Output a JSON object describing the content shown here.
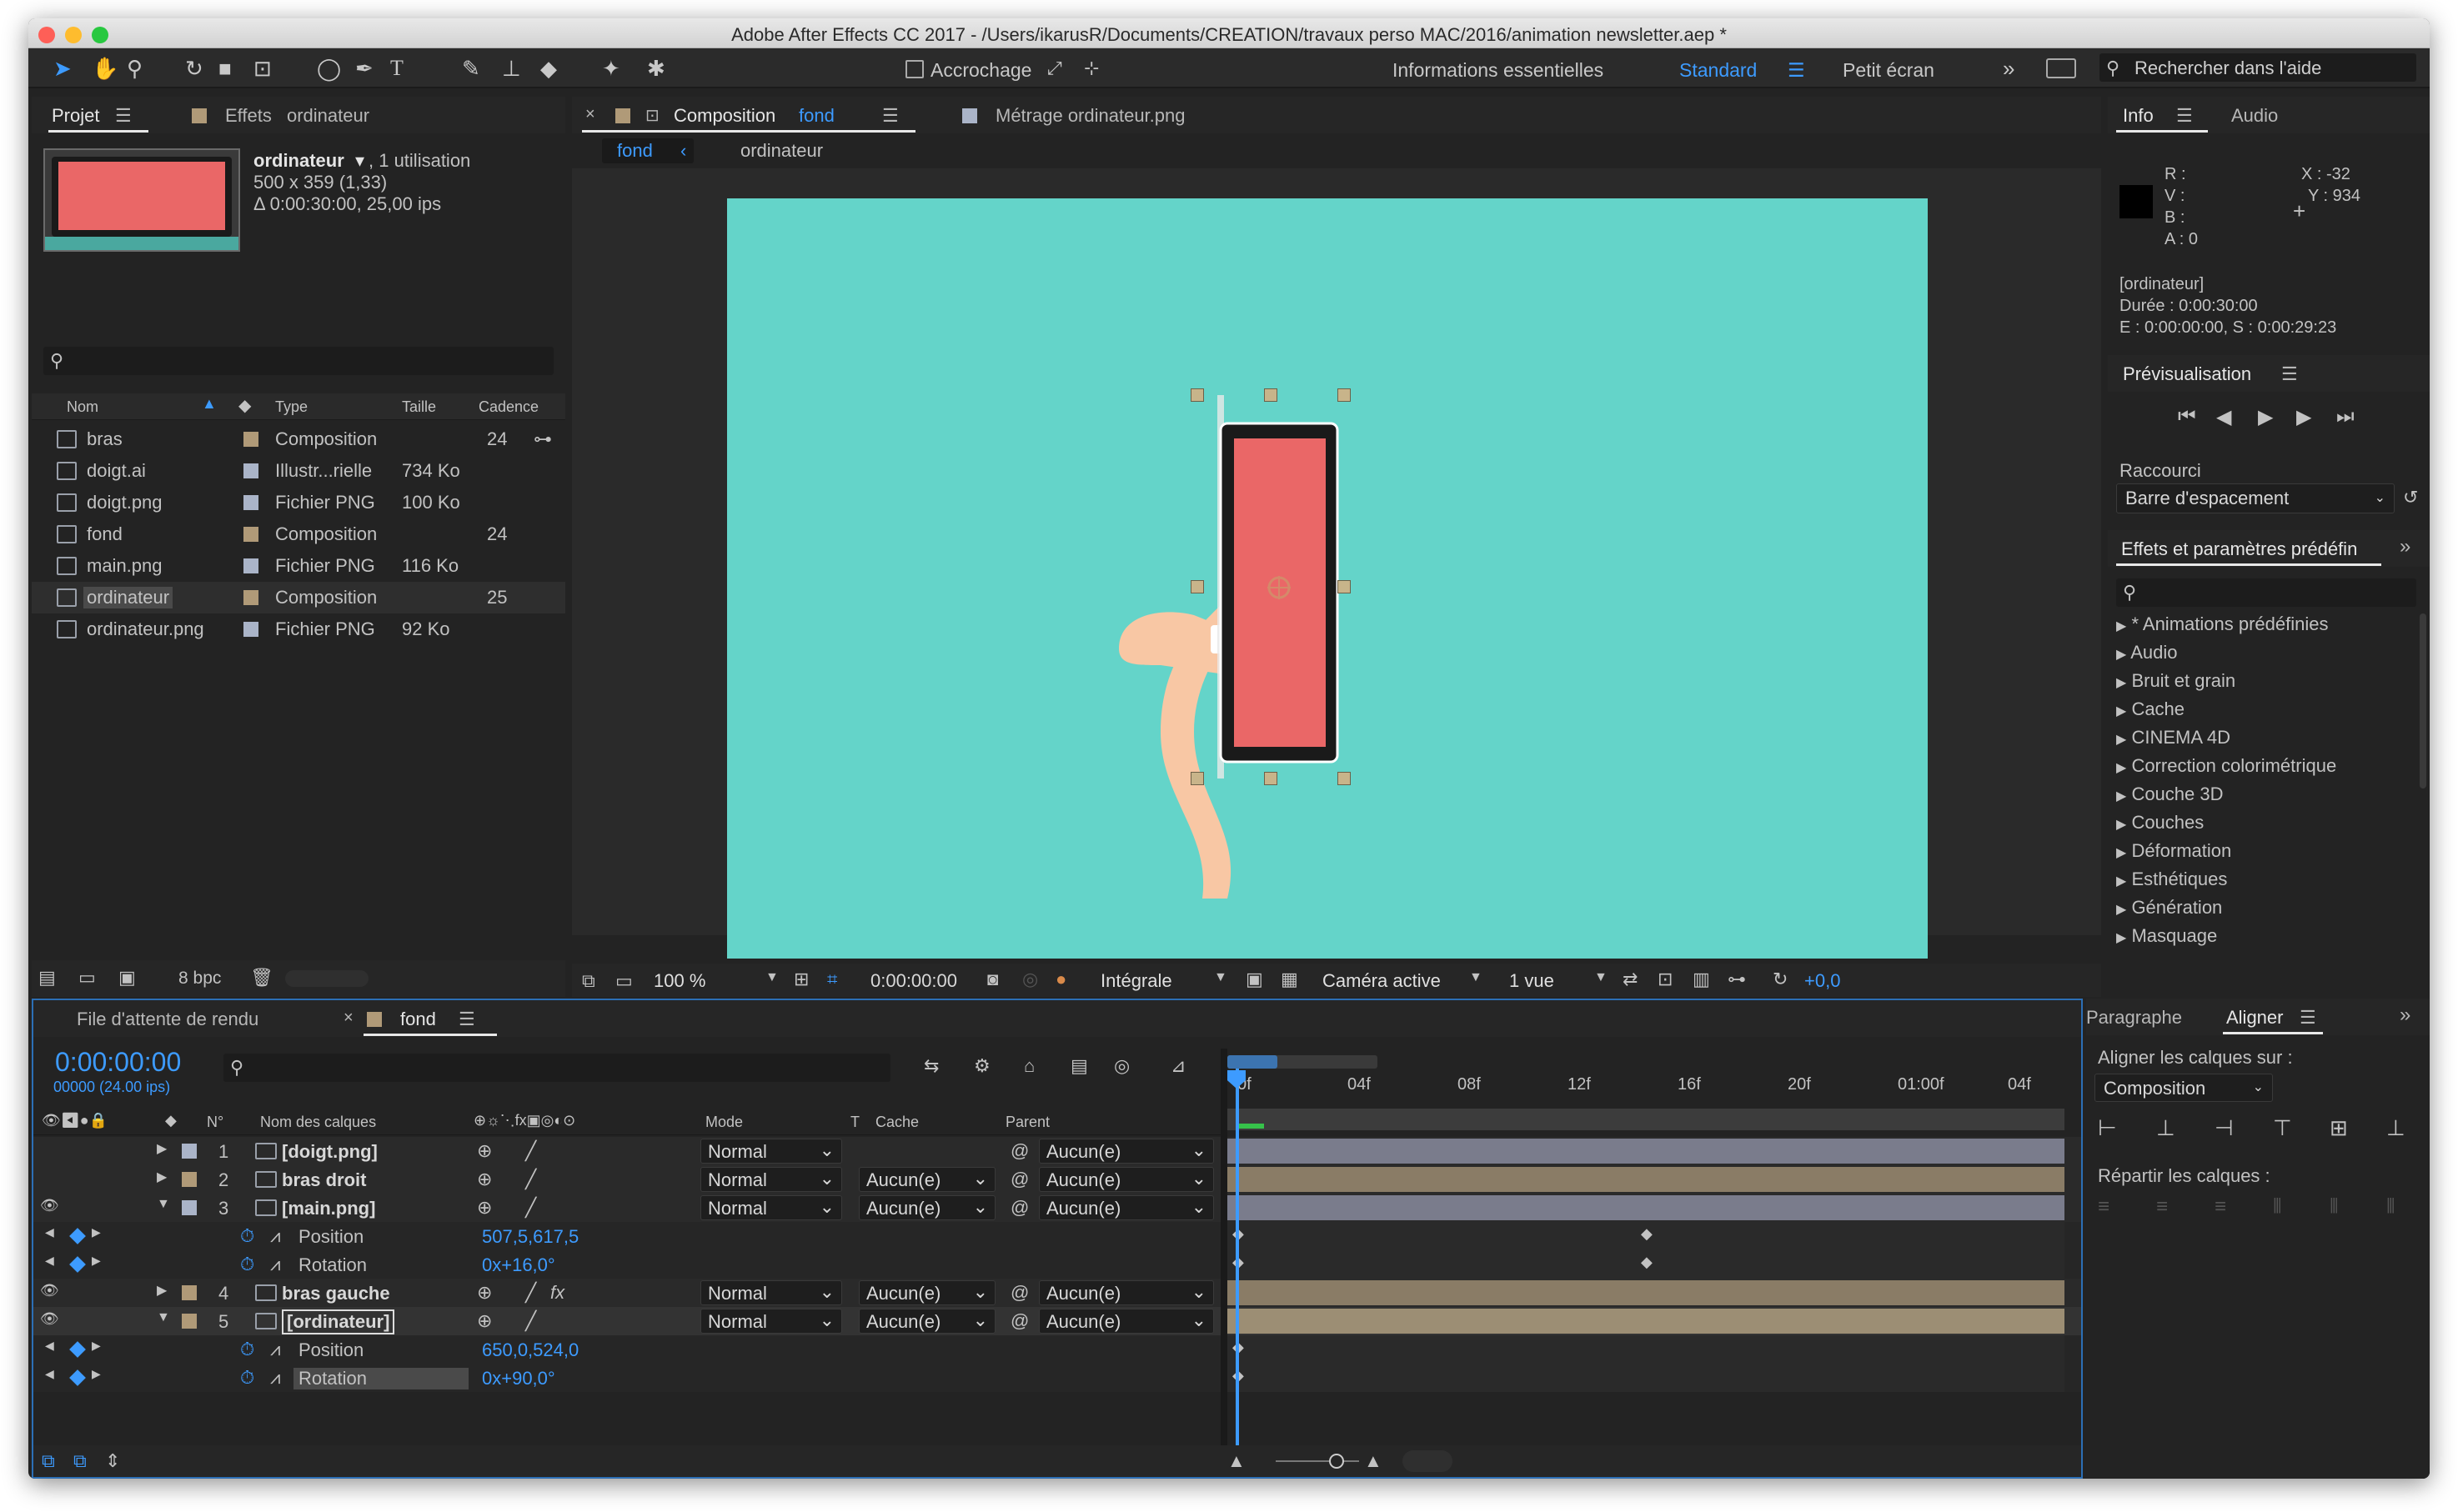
{
  "app": {
    "title": "Adobe After Effects CC 2017 - /Users/ikarusR/Documents/CREATION/travaux perso MAC/2016/animation newsletter.aep *"
  },
  "toolbar": {
    "accrochage": "Accrochage",
    "workspaces": [
      "Informations essentielles",
      "Standard",
      "Petit écran"
    ],
    "search_placeholder": "Rechercher dans l'aide"
  },
  "project": {
    "tab": "Projet",
    "effects_tab": "Effets",
    "effects_target": "ordinateur",
    "preview": {
      "name": "ordinateur",
      "usage": ", 1 utilisation",
      "size": "500 x 359 (1,33)",
      "duration": "Δ 0:00:30:00, 25,00 ips"
    },
    "columns": [
      "Nom",
      "Type",
      "Taille",
      "Cadence"
    ],
    "items": [
      {
        "name": "bras",
        "type": "Composition",
        "size": "",
        "rate": "24",
        "label_color": "#b09a78",
        "icon": "composition-icon"
      },
      {
        "name": "doigt.ai",
        "type": "Illustr...rielle",
        "size": "734 Ko",
        "rate": "",
        "label_color": "#aab4c8",
        "icon": "illustrator-file-icon"
      },
      {
        "name": "doigt.png",
        "type": "Fichier PNG",
        "size": "100 Ko",
        "rate": "",
        "label_color": "#aab4c8",
        "icon": "png-file-icon"
      },
      {
        "name": "fond",
        "type": "Composition",
        "size": "",
        "rate": "24",
        "label_color": "#b09a78",
        "icon": "composition-icon"
      },
      {
        "name": "main.png",
        "type": "Fichier PNG",
        "size": "116 Ko",
        "rate": "",
        "label_color": "#aab4c8",
        "icon": "png-file-icon"
      },
      {
        "name": "ordinateur",
        "type": "Composition",
        "size": "",
        "rate": "25",
        "label_color": "#b09a78",
        "icon": "composition-icon"
      },
      {
        "name": "ordinateur.png",
        "type": "Fichier PNG",
        "size": "92 Ko",
        "rate": "",
        "label_color": "#aab4c8",
        "icon": "png-file-icon"
      }
    ],
    "bpc": "8 bpc"
  },
  "viewer": {
    "comp_tab_prefix": "Composition",
    "comp_tab_name": "fond",
    "footage_tab": "Métrage ordinateur.png",
    "crumb_active": "fond",
    "crumb_child": "ordinateur",
    "zoom": "100 %",
    "timecode": "0:00:00:00",
    "resolution": "Intégrale",
    "camera": "Caméra active",
    "views": "1 vue",
    "exposure": "+0,0",
    "bg_color": "#64d4c9"
  },
  "info": {
    "tab": "Info",
    "audio_tab": "Audio",
    "r": "R :",
    "v": "V :",
    "b": "B :",
    "a": "A : 0",
    "x": "X : -32",
    "y": "Y : 934",
    "layer": "[ordinateur]",
    "duree": "Durée : 0:00:30:00",
    "es": "E : 0:00:00:00, S : 0:00:29:23"
  },
  "preview": {
    "title": "Prévisualisation",
    "raccourci": "Raccourci",
    "shortcut": "Barre d'espacement"
  },
  "effects": {
    "title": "Effets et paramètres prédéfin",
    "items": [
      "* Animations prédéfinies",
      "Audio",
      "Bruit et grain",
      "Cache",
      "CINEMA 4D",
      "Correction colorimétrique",
      "Couche 3D",
      "Couches",
      "Déformation",
      "Esthétiques",
      "Génération",
      "Masquage"
    ]
  },
  "align": {
    "paragraphe": "Paragraphe",
    "aligner": "Aligner",
    "aligner_sur": "Aligner les calques sur :",
    "target": "Composition",
    "repartir": "Répartir les calques :"
  },
  "timeline": {
    "render_queue": "File d'attente de rendu",
    "comp_tab": "fond",
    "timecode": "0:00:00:00",
    "frames": "00000 (24.00 ips)",
    "col_num": "N°",
    "col_name": "Nom des calques",
    "col_mode": "Mode",
    "col_t": "T",
    "col_cache": "Cache",
    "col_parent": "Parent",
    "ruler": [
      "0f",
      "04f",
      "08f",
      "12f",
      "16f",
      "20f",
      "01:00f",
      "04f"
    ],
    "layers": [
      {
        "num": "1",
        "name": "[doigt.png]",
        "mode": "Normal",
        "cache": "",
        "parent": "Aucun(e)",
        "label_color": "#aab4c8",
        "bar_color": "#7a7c8c",
        "eye": false,
        "expanded": false
      },
      {
        "num": "2",
        "name": "bras droit",
        "mode": "Normal",
        "cache": "Aucun(e)",
        "parent": "Aucun(e)",
        "label_color": "#b09a78",
        "bar_color": "#8a7c66",
        "eye": false,
        "expanded": false
      },
      {
        "num": "3",
        "name": "[main.png]",
        "mode": "Normal",
        "cache": "Aucun(e)",
        "parent": "Aucun(e)",
        "label_color": "#aab4c8",
        "bar_color": "#7a7c8c",
        "eye": true,
        "expanded": true
      },
      {
        "num": "4",
        "name": "bras gauche",
        "mode": "Normal",
        "cache": "Aucun(e)",
        "parent": "Aucun(e)",
        "label_color": "#b09a78",
        "bar_color": "#8a7c66",
        "eye": true,
        "expanded": false
      },
      {
        "num": "5",
        "name": "[ordinateur]",
        "mode": "Normal",
        "cache": "Aucun(e)",
        "parent": "Aucun(e)",
        "label_color": "#b09a78",
        "bar_color": "#9c8e74",
        "eye": true,
        "expanded": true
      }
    ],
    "props3": [
      {
        "name": "Position",
        "value": "507,5,617,5"
      },
      {
        "name": "Rotation",
        "value": "0x+16,0°"
      }
    ],
    "props5": [
      {
        "name": "Position",
        "value": "650,0,524,0"
      },
      {
        "name": "Rotation",
        "value": "0x+90,0°"
      }
    ]
  }
}
